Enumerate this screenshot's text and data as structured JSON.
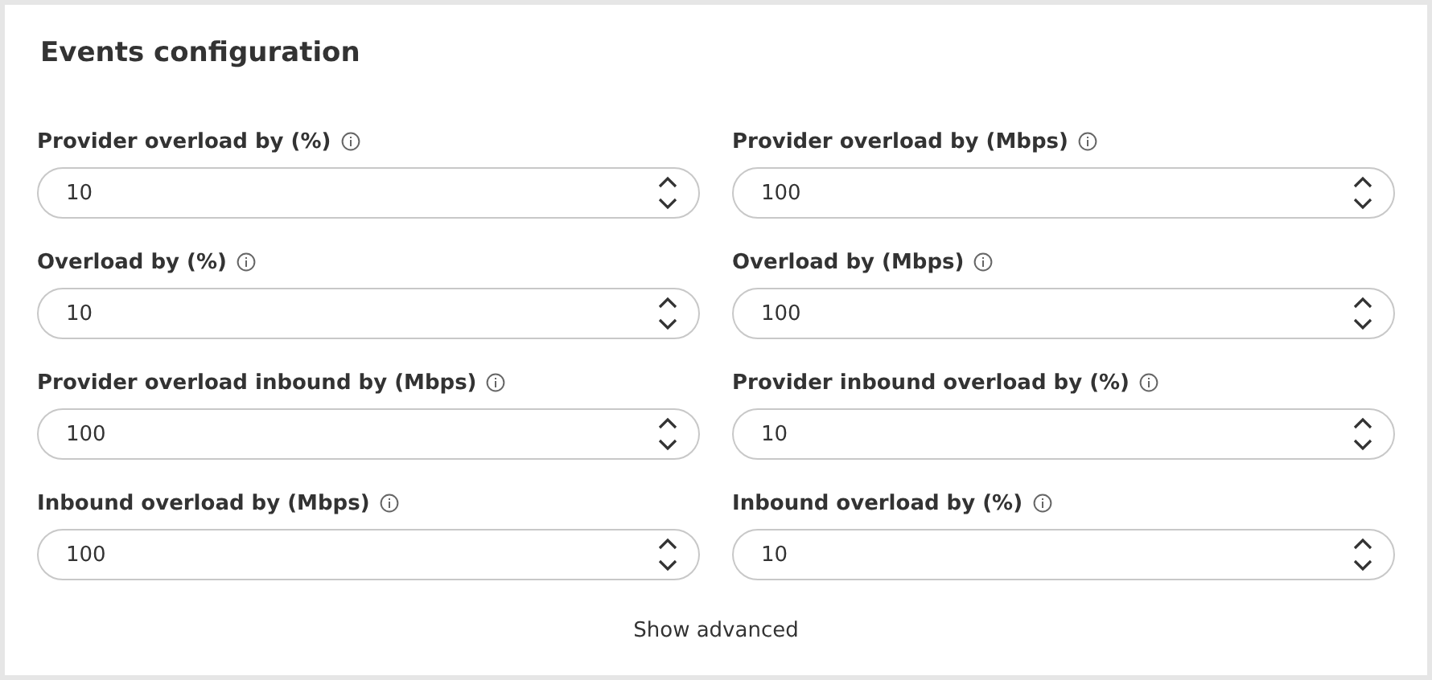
{
  "title": "Events configuration",
  "fields": [
    {
      "label": "Provider overload by (%)",
      "value": "10"
    },
    {
      "label": "Provider overload by (Mbps)",
      "value": "100"
    },
    {
      "label": "Overload by (%)",
      "value": "10"
    },
    {
      "label": "Overload by (Mbps)",
      "value": "100"
    },
    {
      "label": "Provider overload inbound by (Mbps)",
      "value": "100"
    },
    {
      "label": "Provider inbound overload by (%)",
      "value": "10"
    },
    {
      "label": "Inbound overload by (Mbps)",
      "value": "100"
    },
    {
      "label": "Inbound overload by (%)",
      "value": "10"
    }
  ],
  "link": "Show advanced"
}
